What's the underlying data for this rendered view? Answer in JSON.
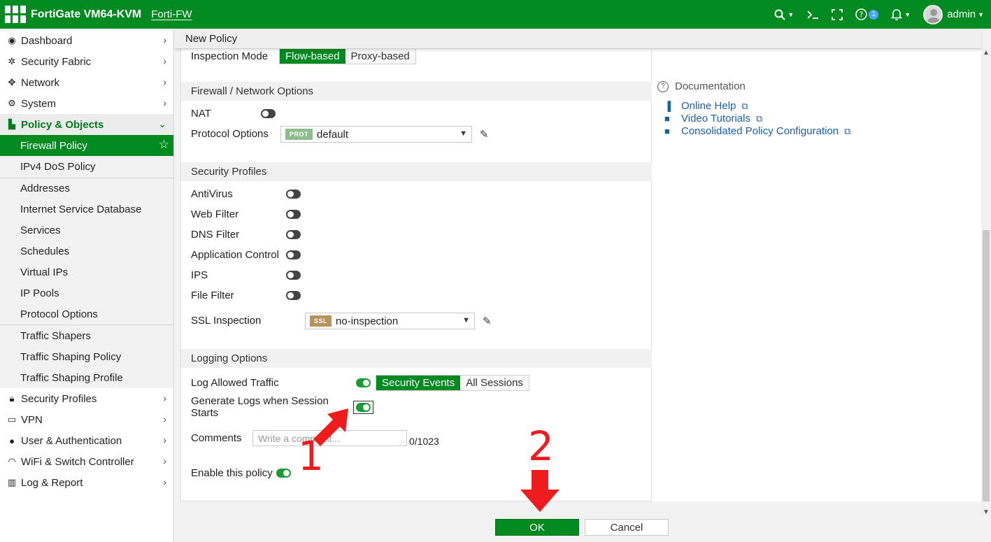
{
  "header": {
    "brand": "FortiGate VM64-KVM",
    "hostname": "Forti-FW",
    "notification_count": "1",
    "user": "admin"
  },
  "sidebar": {
    "items": [
      {
        "label": "Dashboard",
        "icon": "dashboard-icon"
      },
      {
        "label": "Security Fabric",
        "icon": "fabric-icon"
      },
      {
        "label": "Network",
        "icon": "network-icon"
      },
      {
        "label": "System",
        "icon": "gear-icon"
      },
      {
        "label": "Policy & Objects",
        "icon": "policy-icon"
      },
      {
        "label": "Security Profiles",
        "icon": "lock-icon"
      },
      {
        "label": "VPN",
        "icon": "laptop-icon"
      },
      {
        "label": "User & Authentication",
        "icon": "user-icon"
      },
      {
        "label": "WiFi & Switch Controller",
        "icon": "wifi-icon"
      },
      {
        "label": "Log & Report",
        "icon": "chart-icon"
      }
    ],
    "policy_sub": [
      "Firewall Policy",
      "IPv4 DoS Policy",
      "Addresses",
      "Internet Service Database",
      "Services",
      "Schedules",
      "Virtual IPs",
      "IP Pools",
      "Protocol Options",
      "Traffic Shapers",
      "Traffic Shaping Policy",
      "Traffic Shaping Profile"
    ]
  },
  "page": {
    "title": "New Policy"
  },
  "form": {
    "inspection_mode_label": "Inspection Mode",
    "inspection_flow": "Flow-based",
    "inspection_proxy": "Proxy-based",
    "firewall_section": "Firewall / Network Options",
    "nat_label": "NAT",
    "protocol_options_label": "Protocol Options",
    "protocol_tag": "PROT",
    "protocol_value": "default",
    "security_section": "Security Profiles",
    "antivirus": "AntiVirus",
    "web_filter": "Web Filter",
    "dns_filter": "DNS Filter",
    "app_control": "Application Control",
    "ips": "IPS",
    "file_filter": "File Filter",
    "ssl_label": "SSL Inspection",
    "ssl_tag": "SSL",
    "ssl_value": "no-inspection",
    "logging_section": "Logging Options",
    "log_allowed": "Log Allowed Traffic",
    "log_security_events": "Security Events",
    "log_all_sessions": "All Sessions",
    "log_session_start": "Generate Logs when Session Starts",
    "comments_label": "Comments",
    "comments_placeholder": "Write a comment...",
    "comments_count": "0/1023",
    "enable_policy": "Enable this policy"
  },
  "docs": {
    "title": "Documentation",
    "links": [
      "Online Help",
      "Video Tutorials",
      "Consolidated Policy Configuration"
    ]
  },
  "buttons": {
    "ok": "OK",
    "cancel": "Cancel"
  },
  "annotations": {
    "step1": "1",
    "step2": "2"
  },
  "colors": {
    "brand_green": "#008a1f",
    "annotation_red": "#ee1c1c"
  }
}
